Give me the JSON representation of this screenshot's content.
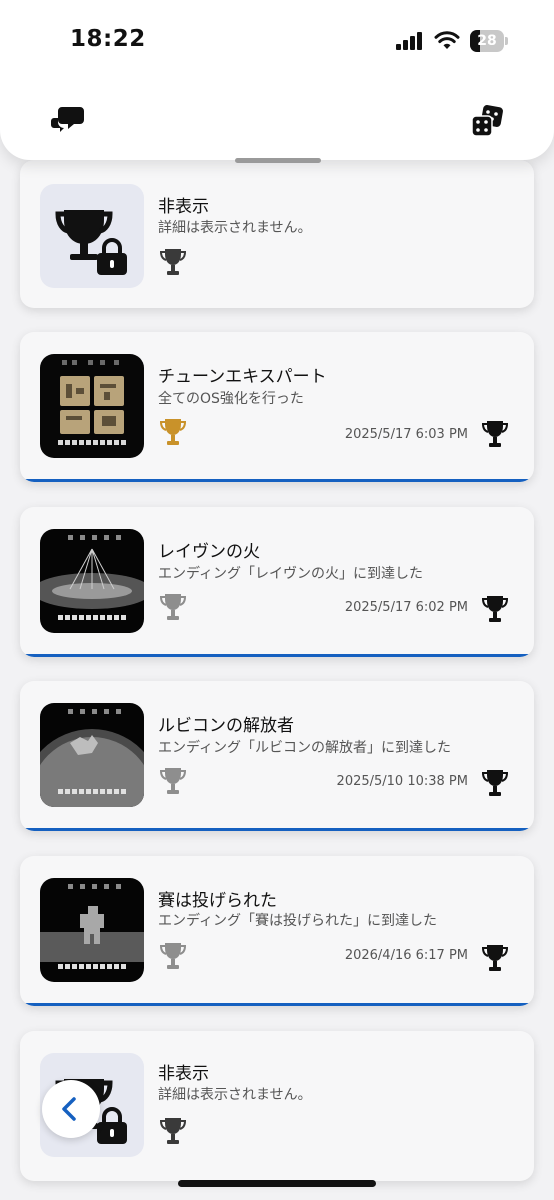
{
  "status_bar": {
    "time": "18:22",
    "battery": "28",
    "battery_level": 0.28
  },
  "header": {
    "left_icon": "chat-bubbles-icon",
    "right_icon": "dice-icon"
  },
  "trophies": [
    {
      "title": "非表示",
      "description": "詳細は表示されません。",
      "grade": "silver",
      "hidden": true,
      "date": ""
    },
    {
      "title": "チューンエキスパート",
      "description": "全てのOS強化を行った",
      "grade": "gold",
      "hidden": false,
      "date": "2025/5/17  6:03 PM"
    },
    {
      "title": "レイヴンの火",
      "description": "エンディング「レイヴンの火」に到達した",
      "grade": "silver",
      "hidden": false,
      "date": "2025/5/17  6:02 PM"
    },
    {
      "title": "ルビコンの解放者",
      "description": "エンディング「ルビコンの解放者」に到達した",
      "grade": "silver",
      "hidden": false,
      "date": "2025/5/10  10:38 PM"
    },
    {
      "title": "賽は投げられた",
      "description": "エンディング「賽は投げられた」に到達した",
      "grade": "silver",
      "hidden": false,
      "date": "2026/4/16  6:17 PM"
    },
    {
      "title": "非表示",
      "description": "詳細は表示されません。",
      "grade": "silver",
      "hidden": true,
      "date": ""
    }
  ],
  "colors": {
    "gold": "#c9922a",
    "silver": "#8e8e8e",
    "accent": "#1560c0"
  }
}
